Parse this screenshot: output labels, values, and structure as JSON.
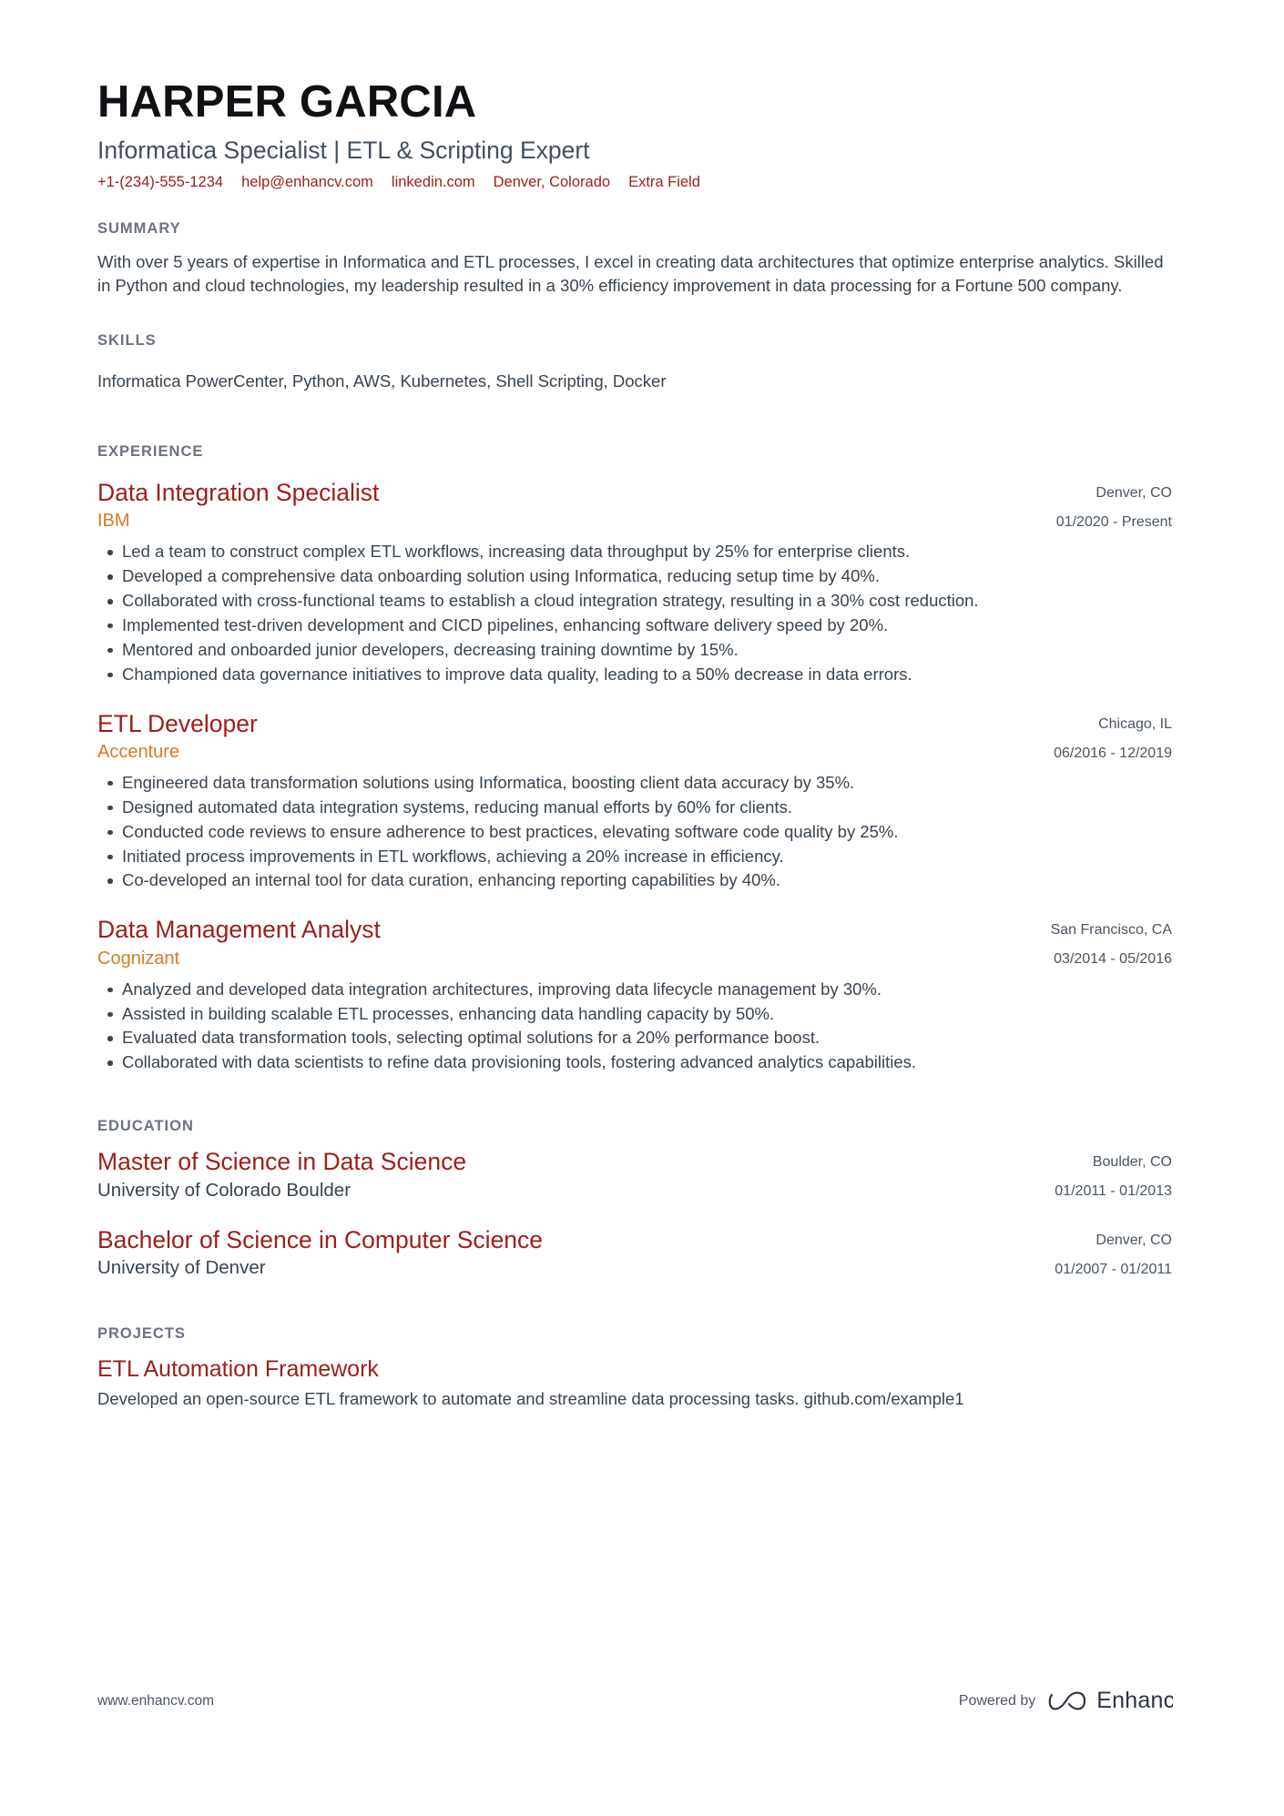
{
  "header": {
    "name": "HARPER GARCIA",
    "headline": "Informatica Specialist | ETL & Scripting Expert",
    "contacts": [
      {
        "label": "+1-(234)-555-1234",
        "icon": "phone-icon"
      },
      {
        "label": "help@enhancv.com",
        "icon": "email-icon"
      },
      {
        "label": "linkedin.com",
        "icon": "link-icon"
      },
      {
        "label": "Denver, Colorado",
        "icon": "location-icon"
      },
      {
        "label": "Extra Field",
        "icon": "info-icon"
      }
    ]
  },
  "summary": {
    "title": "SUMMARY",
    "text": "With over 5 years of expertise in Informatica and ETL processes, I excel in creating data architectures that optimize enterprise analytics. Skilled in Python and cloud technologies, my leadership resulted in a 30% efficiency improvement in data processing for a Fortune 500 company."
  },
  "skills": {
    "title": "SKILLS",
    "list": "Informatica PowerCenter, Python, AWS, Kubernetes, Shell Scripting, Docker"
  },
  "experience": {
    "title": "EXPERIENCE",
    "entries": [
      {
        "role": "Data Integration Specialist",
        "company": "IBM",
        "location": "Denver, CO",
        "dates": "01/2020 - Present",
        "bullets": [
          "Led a team to construct complex ETL workflows, increasing data throughput by 25% for enterprise clients.",
          "Developed a comprehensive data onboarding solution using Informatica, reducing setup time by 40%.",
          "Collaborated with cross-functional teams to establish a cloud integration strategy, resulting in a 30% cost reduction.",
          "Implemented test-driven development and CICD pipelines, enhancing software delivery speed by 20%.",
          "Mentored and onboarded junior developers, decreasing training downtime by 15%.",
          "Championed data governance initiatives to improve data quality, leading to a 50% decrease in data errors."
        ]
      },
      {
        "role": "ETL Developer",
        "company": "Accenture",
        "location": "Chicago, IL",
        "dates": "06/2016 - 12/2019",
        "bullets": [
          "Engineered data transformation solutions using Informatica, boosting client data accuracy by 35%.",
          "Designed automated data integration systems, reducing manual efforts by 60% for clients.",
          "Conducted code reviews to ensure adherence to best practices, elevating software code quality by 25%.",
          "Initiated process improvements in ETL workflows, achieving a 20% increase in efficiency.",
          "Co-developed an internal tool for data curation, enhancing reporting capabilities by 40%."
        ]
      },
      {
        "role": "Data Management Analyst",
        "company": "Cognizant",
        "location": "San Francisco, CA",
        "dates": "03/2014 - 05/2016",
        "bullets": [
          "Analyzed and developed data integration architectures, improving data lifecycle management by 30%.",
          "Assisted in building scalable ETL processes, enhancing data handling capacity by 50%.",
          "Evaluated data transformation tools, selecting optimal solutions for a 20% performance boost.",
          "Collaborated with data scientists to refine data provisioning tools, fostering advanced analytics capabilities."
        ]
      }
    ]
  },
  "education": {
    "title": "EDUCATION",
    "entries": [
      {
        "degree": "Master of Science in Data Science",
        "school": "University of Colorado Boulder",
        "location": "Boulder, CO",
        "dates": "01/2011 - 01/2013"
      },
      {
        "degree": "Bachelor of Science in Computer Science",
        "school": "University of Denver",
        "location": "Denver, CO",
        "dates": "01/2007 - 01/2011"
      }
    ]
  },
  "projects": {
    "title": "PROJECTS",
    "entries": [
      {
        "name": "ETL Automation Framework",
        "description": "Developed an open-source ETL framework to automate and streamline data processing tasks. github.com/example1"
      }
    ]
  },
  "footer": {
    "url": "www.enhancv.com",
    "powered_by": "Powered by",
    "brand": "Enhancv"
  },
  "colors": {
    "accent_red": "#9c1f18",
    "accent_orange": "#d97a29",
    "section_gray": "#6b7280",
    "body_text": "#38444f",
    "name_black": "#0f1115"
  }
}
